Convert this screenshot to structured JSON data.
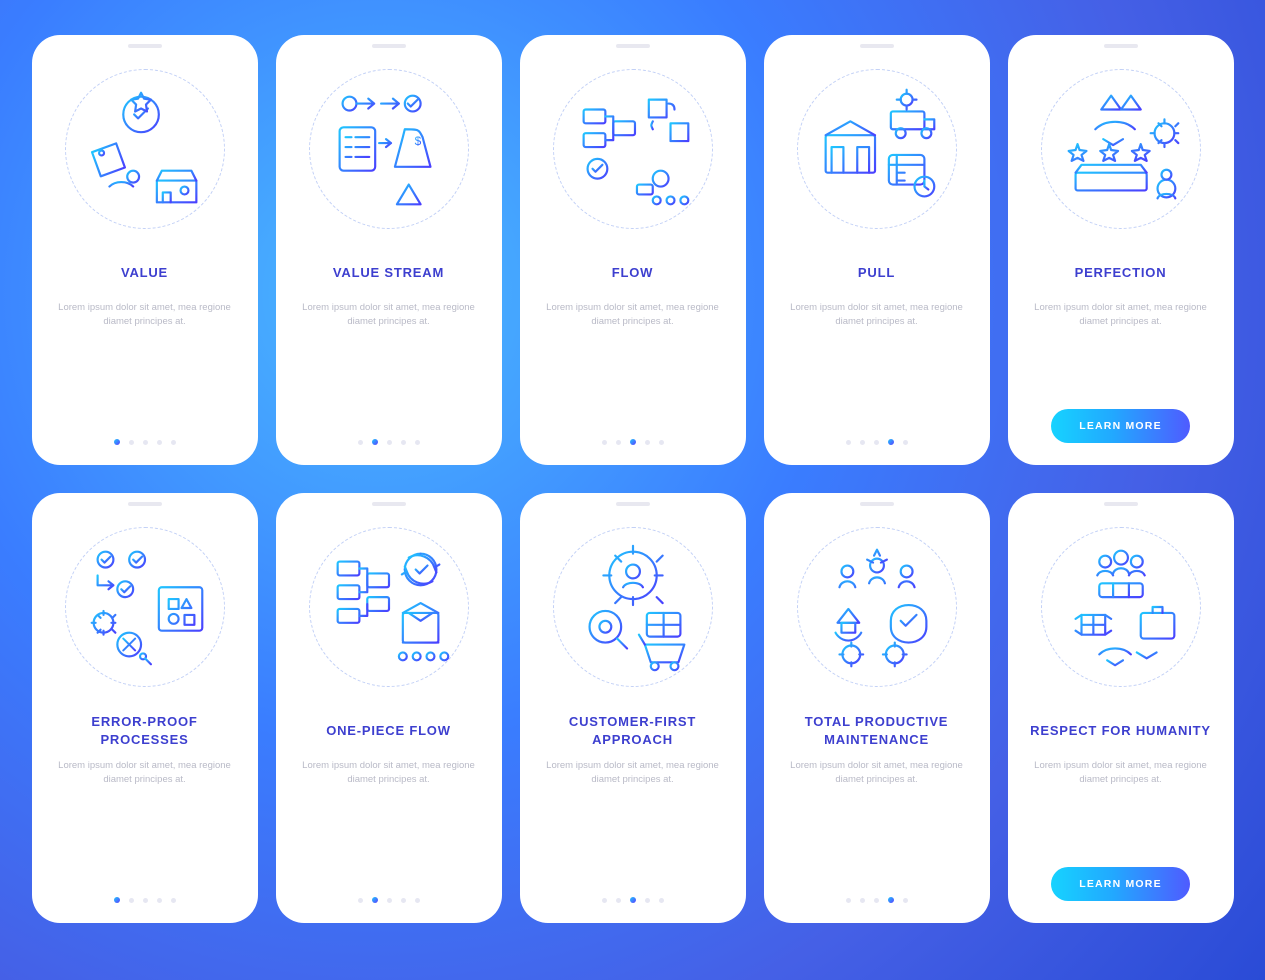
{
  "cta_label": "LEARN MORE",
  "screens": [
    {
      "title": "VALUE",
      "desc": "Lorem ipsum dolor sit amet, mea regione diamet principes at.",
      "active": 0,
      "cta": false
    },
    {
      "title": "VALUE STREAM",
      "desc": "Lorem ipsum dolor sit amet, mea regione diamet principes at.",
      "active": 1,
      "cta": false
    },
    {
      "title": "FLOW",
      "desc": "Lorem ipsum dolor sit amet, mea regione diamet principes at.",
      "active": 2,
      "cta": false
    },
    {
      "title": "PULL",
      "desc": "Lorem ipsum dolor sit amet, mea regione diamet principes at.",
      "active": 3,
      "cta": false
    },
    {
      "title": "PERFECTION",
      "desc": "Lorem ipsum dolor sit amet, mea regione diamet principes at.",
      "active": 4,
      "cta": true
    },
    {
      "title": "ERROR-PROOF PROCESSES",
      "desc": "Lorem ipsum dolor sit amet, mea regione diamet principes at.",
      "active": 0,
      "cta": false
    },
    {
      "title": "ONE-PIECE FLOW",
      "desc": "Lorem ipsum dolor sit amet, mea regione diamet principes at.",
      "active": 1,
      "cta": false
    },
    {
      "title": "CUSTOMER-FIRST APPROACH",
      "desc": "Lorem ipsum dolor sit amet, mea regione diamet principes at.",
      "active": 2,
      "cta": false
    },
    {
      "title": "TOTAL PRODUCTIVE MAINTENANCE",
      "desc": "Lorem ipsum dolor sit amet, mea regione diamet principes at.",
      "active": 3,
      "cta": false
    },
    {
      "title": "RESPECT FOR HUMANITY",
      "desc": "Lorem ipsum dolor sit amet, mea regione diamet principes at.",
      "active": 4,
      "cta": true
    }
  ],
  "colors": {
    "grad_a": "#1fc6ff",
    "grad_b": "#4a3fff"
  }
}
